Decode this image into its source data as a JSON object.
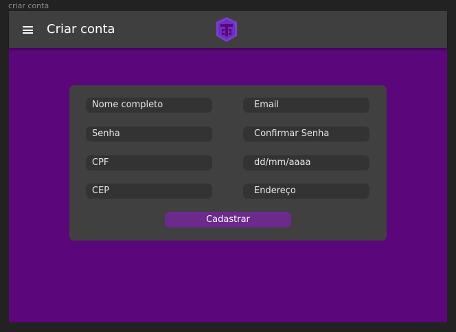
{
  "window": {
    "title": "criar conta"
  },
  "appbar": {
    "menu_icon": "hamburger-menu-icon",
    "title": "Criar conta",
    "logo_icon": "shield-ts-logo"
  },
  "form": {
    "fields": {
      "nome": {
        "placeholder": "Nome completo",
        "value": ""
      },
      "email": {
        "placeholder": "Email",
        "value": ""
      },
      "senha": {
        "placeholder": "Senha",
        "value": ""
      },
      "confirmar_senha": {
        "placeholder": "Confirmar Senha",
        "value": ""
      },
      "cpf": {
        "placeholder": "CPF",
        "value": ""
      },
      "data": {
        "placeholder": "dd/mm/aaaa",
        "value": ""
      },
      "cep": {
        "placeholder": "CEP",
        "value": ""
      },
      "endereco": {
        "placeholder": "Endereço",
        "value": ""
      }
    },
    "submit_label": "Cadastrar"
  },
  "colors": {
    "background": "#5c067c",
    "appbar": "#3f3f3f",
    "card": "#404040",
    "field": "#333333",
    "button": "#6b2a8c",
    "logo": "#7b3fd0"
  }
}
